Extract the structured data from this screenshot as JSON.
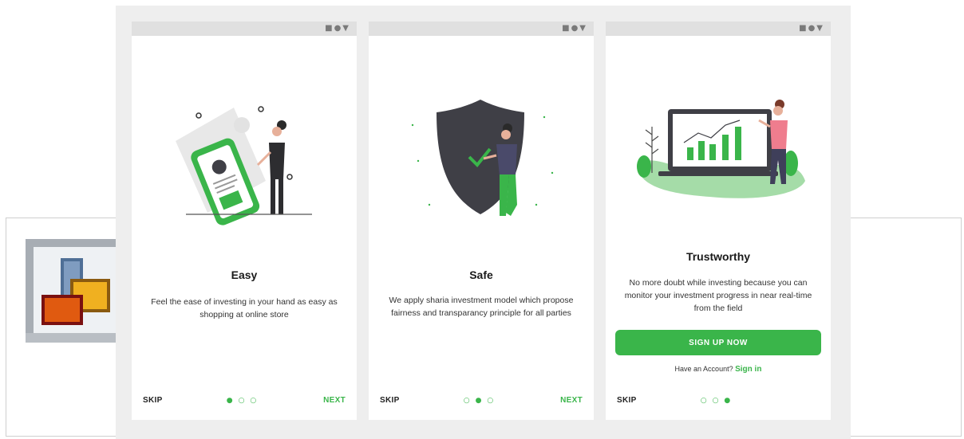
{
  "screens": [
    {
      "status_icons": "■●▼",
      "title": "Easy",
      "description": "Feel the ease of investing in your hand as easy as shopping at online store",
      "skip_label": "SKIP",
      "next_label": "NEXT",
      "dots": "●○○",
      "illustration": "phone-document-person"
    },
    {
      "status_icons": "■●▼",
      "title": "Safe",
      "description": "We apply sharia investment model which propose fairness and transparancy principle for all parties",
      "skip_label": "SKIP",
      "next_label": "NEXT",
      "dots": "○●○",
      "illustration": "shield-person"
    },
    {
      "status_icons": "■●▼",
      "title": "Trustworthy",
      "description": "No more doubt while investing because you can monitor your investment progress in near real-time from the field",
      "signup_label": "SIGN UP NOW",
      "have_account_text": "Have an Account?",
      "signin_label": "Sign in",
      "skip_label": "SKIP",
      "dots": "○○●",
      "illustration": "laptop-chart-person"
    }
  ],
  "colors": {
    "accent": "#3ab54a",
    "stage_bg": "#eeeeee",
    "status_bar": "#e0e0e0"
  }
}
